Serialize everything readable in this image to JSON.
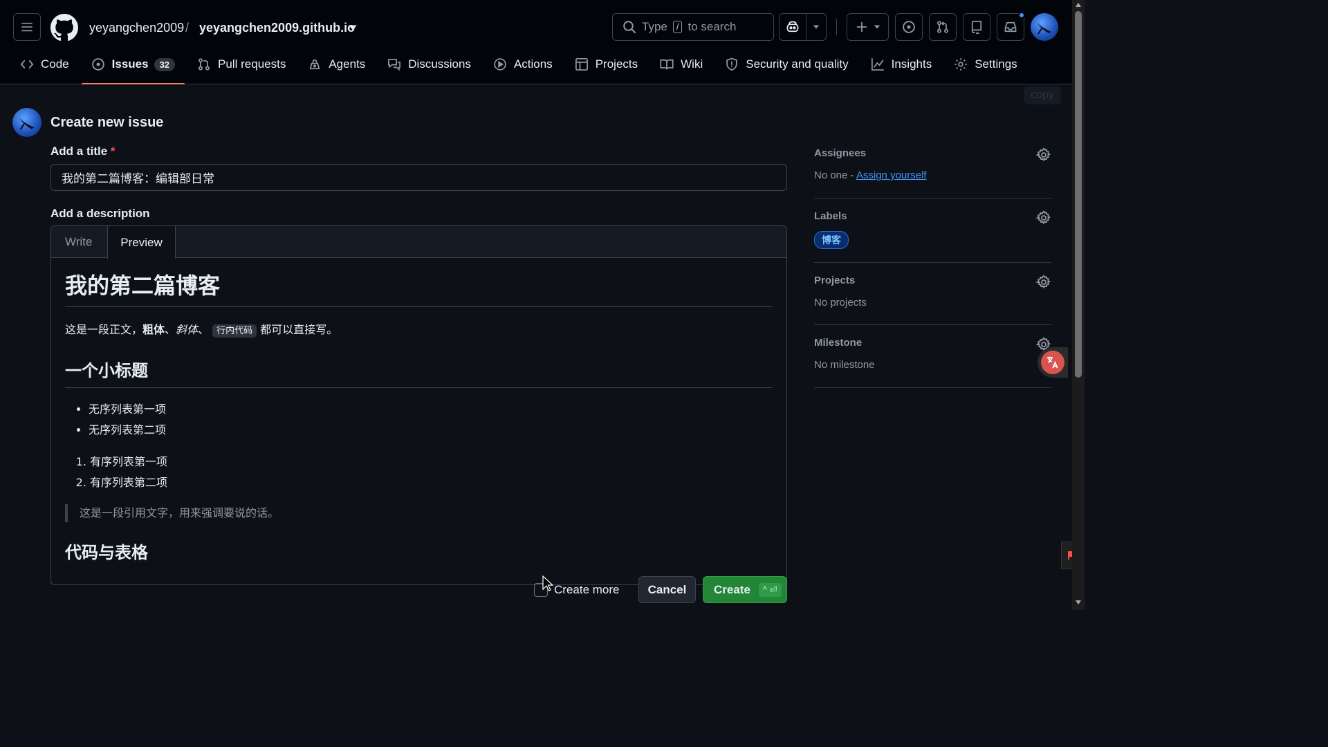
{
  "header": {
    "owner": "yeyangchen2009",
    "separator": "/",
    "repo": "yeyangchen2009.github.io",
    "search": {
      "prefix": "Type",
      "key": "/",
      "suffix": "to search"
    }
  },
  "tabs": [
    {
      "label": "Code",
      "icon": "code-icon"
    },
    {
      "label": "Issues",
      "icon": "issue-opened-icon",
      "count": "32",
      "active": true
    },
    {
      "label": "Pull requests",
      "icon": "git-pull-request-icon"
    },
    {
      "label": "Agents",
      "icon": "agents-icon"
    },
    {
      "label": "Discussions",
      "icon": "comment-discussion-icon"
    },
    {
      "label": "Actions",
      "icon": "play-icon"
    },
    {
      "label": "Projects",
      "icon": "table-icon"
    },
    {
      "label": "Wiki",
      "icon": "book-icon"
    },
    {
      "label": "Security and quality",
      "icon": "shield-icon"
    },
    {
      "label": "Insights",
      "icon": "graph-icon"
    },
    {
      "label": "Settings",
      "icon": "gear-icon"
    }
  ],
  "copy_badge": "copy",
  "form": {
    "heading": "Create new issue",
    "title_label": "Add a title",
    "required_mark": "*",
    "title_value": "我的第二篇博客：编辑部日常",
    "description_label": "Add a description",
    "write_tab": "Write",
    "preview_tab": "Preview"
  },
  "preview": {
    "h1": "我的第二篇博客",
    "para_start": "这是一段正文，",
    "bold": "粗体",
    "sep1": "、",
    "italic": "斜体",
    "sep2": "、",
    "code": "行内代码",
    "para_end": "都可以直接写。",
    "h2a": "一个小标题",
    "ul": [
      "无序列表第一项",
      "无序列表第二项"
    ],
    "ol": [
      "有序列表第一项",
      "有序列表第二项"
    ],
    "quote": "这是一段引用文字，用来强调要说的话。",
    "h2b": "代码与表格"
  },
  "footer": {
    "create_more": "Create more",
    "cancel": "Cancel",
    "create": "Create",
    "shortcut": "^ ⏎"
  },
  "sidebar": {
    "assignees": {
      "title": "Assignees",
      "none": "No one - ",
      "link": "Assign yourself"
    },
    "labels": {
      "title": "Labels",
      "chip": "博客"
    },
    "projects": {
      "title": "Projects",
      "value": "No projects"
    },
    "milestone": {
      "title": "Milestone",
      "value": "No milestone"
    }
  },
  "colors": {
    "accent_underline": "#f78166",
    "create_button": "#238636",
    "link": "#4493f8",
    "label_chip": "#1f6feb"
  }
}
